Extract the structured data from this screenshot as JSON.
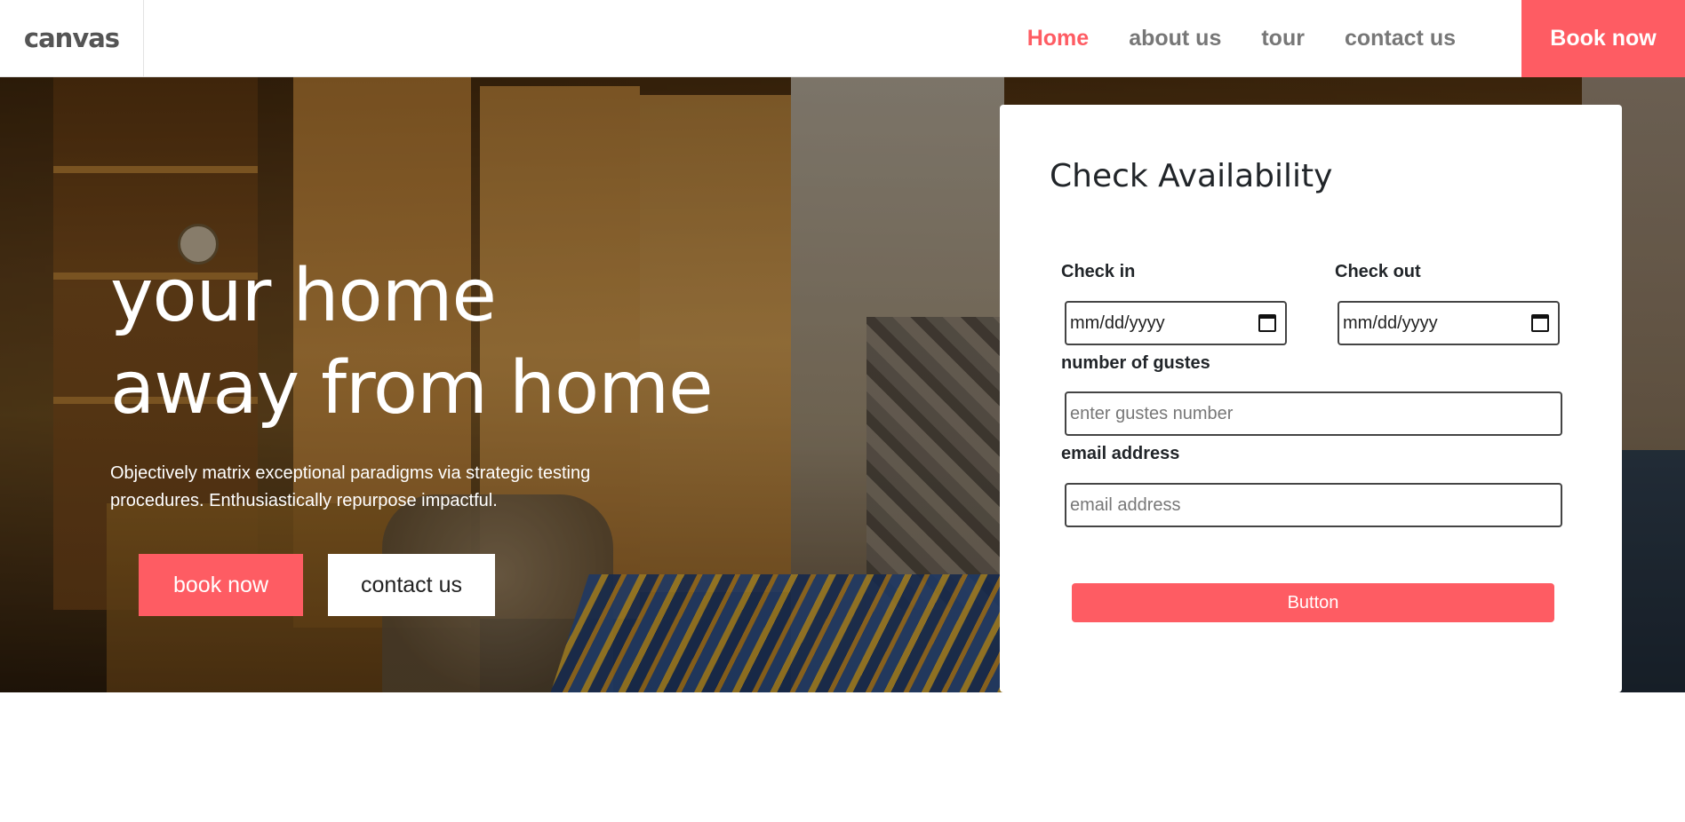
{
  "brand": {
    "logo_text": "canvas"
  },
  "nav": {
    "links": [
      {
        "label": "Home",
        "active": true
      },
      {
        "label": "about us",
        "active": false
      },
      {
        "label": "tour",
        "active": false
      },
      {
        "label": "contact us",
        "active": false
      }
    ],
    "cta_label": "Book now"
  },
  "hero": {
    "title_line1": "your home",
    "title_line2": "away from home",
    "description": "Objectively matrix exceptional paradigms via strategic testing procedures. Enthusiastically repurpose impactful.",
    "primary_button": "book now",
    "secondary_button": "contact us"
  },
  "booking_form": {
    "title": "Check Availability",
    "check_in": {
      "label": "Check in",
      "value": "mm/dd/yyyy"
    },
    "check_out": {
      "label": "Check out",
      "value": "mm/dd/yyyy"
    },
    "guests": {
      "label": "number of gustes",
      "placeholder": "enter gustes number"
    },
    "email": {
      "label": "email address",
      "placeholder": "email address"
    },
    "submit_label": "Button"
  },
  "colors": {
    "accent": "#fe5c63",
    "nav_text": "#777777",
    "heading_text": "#212529"
  }
}
